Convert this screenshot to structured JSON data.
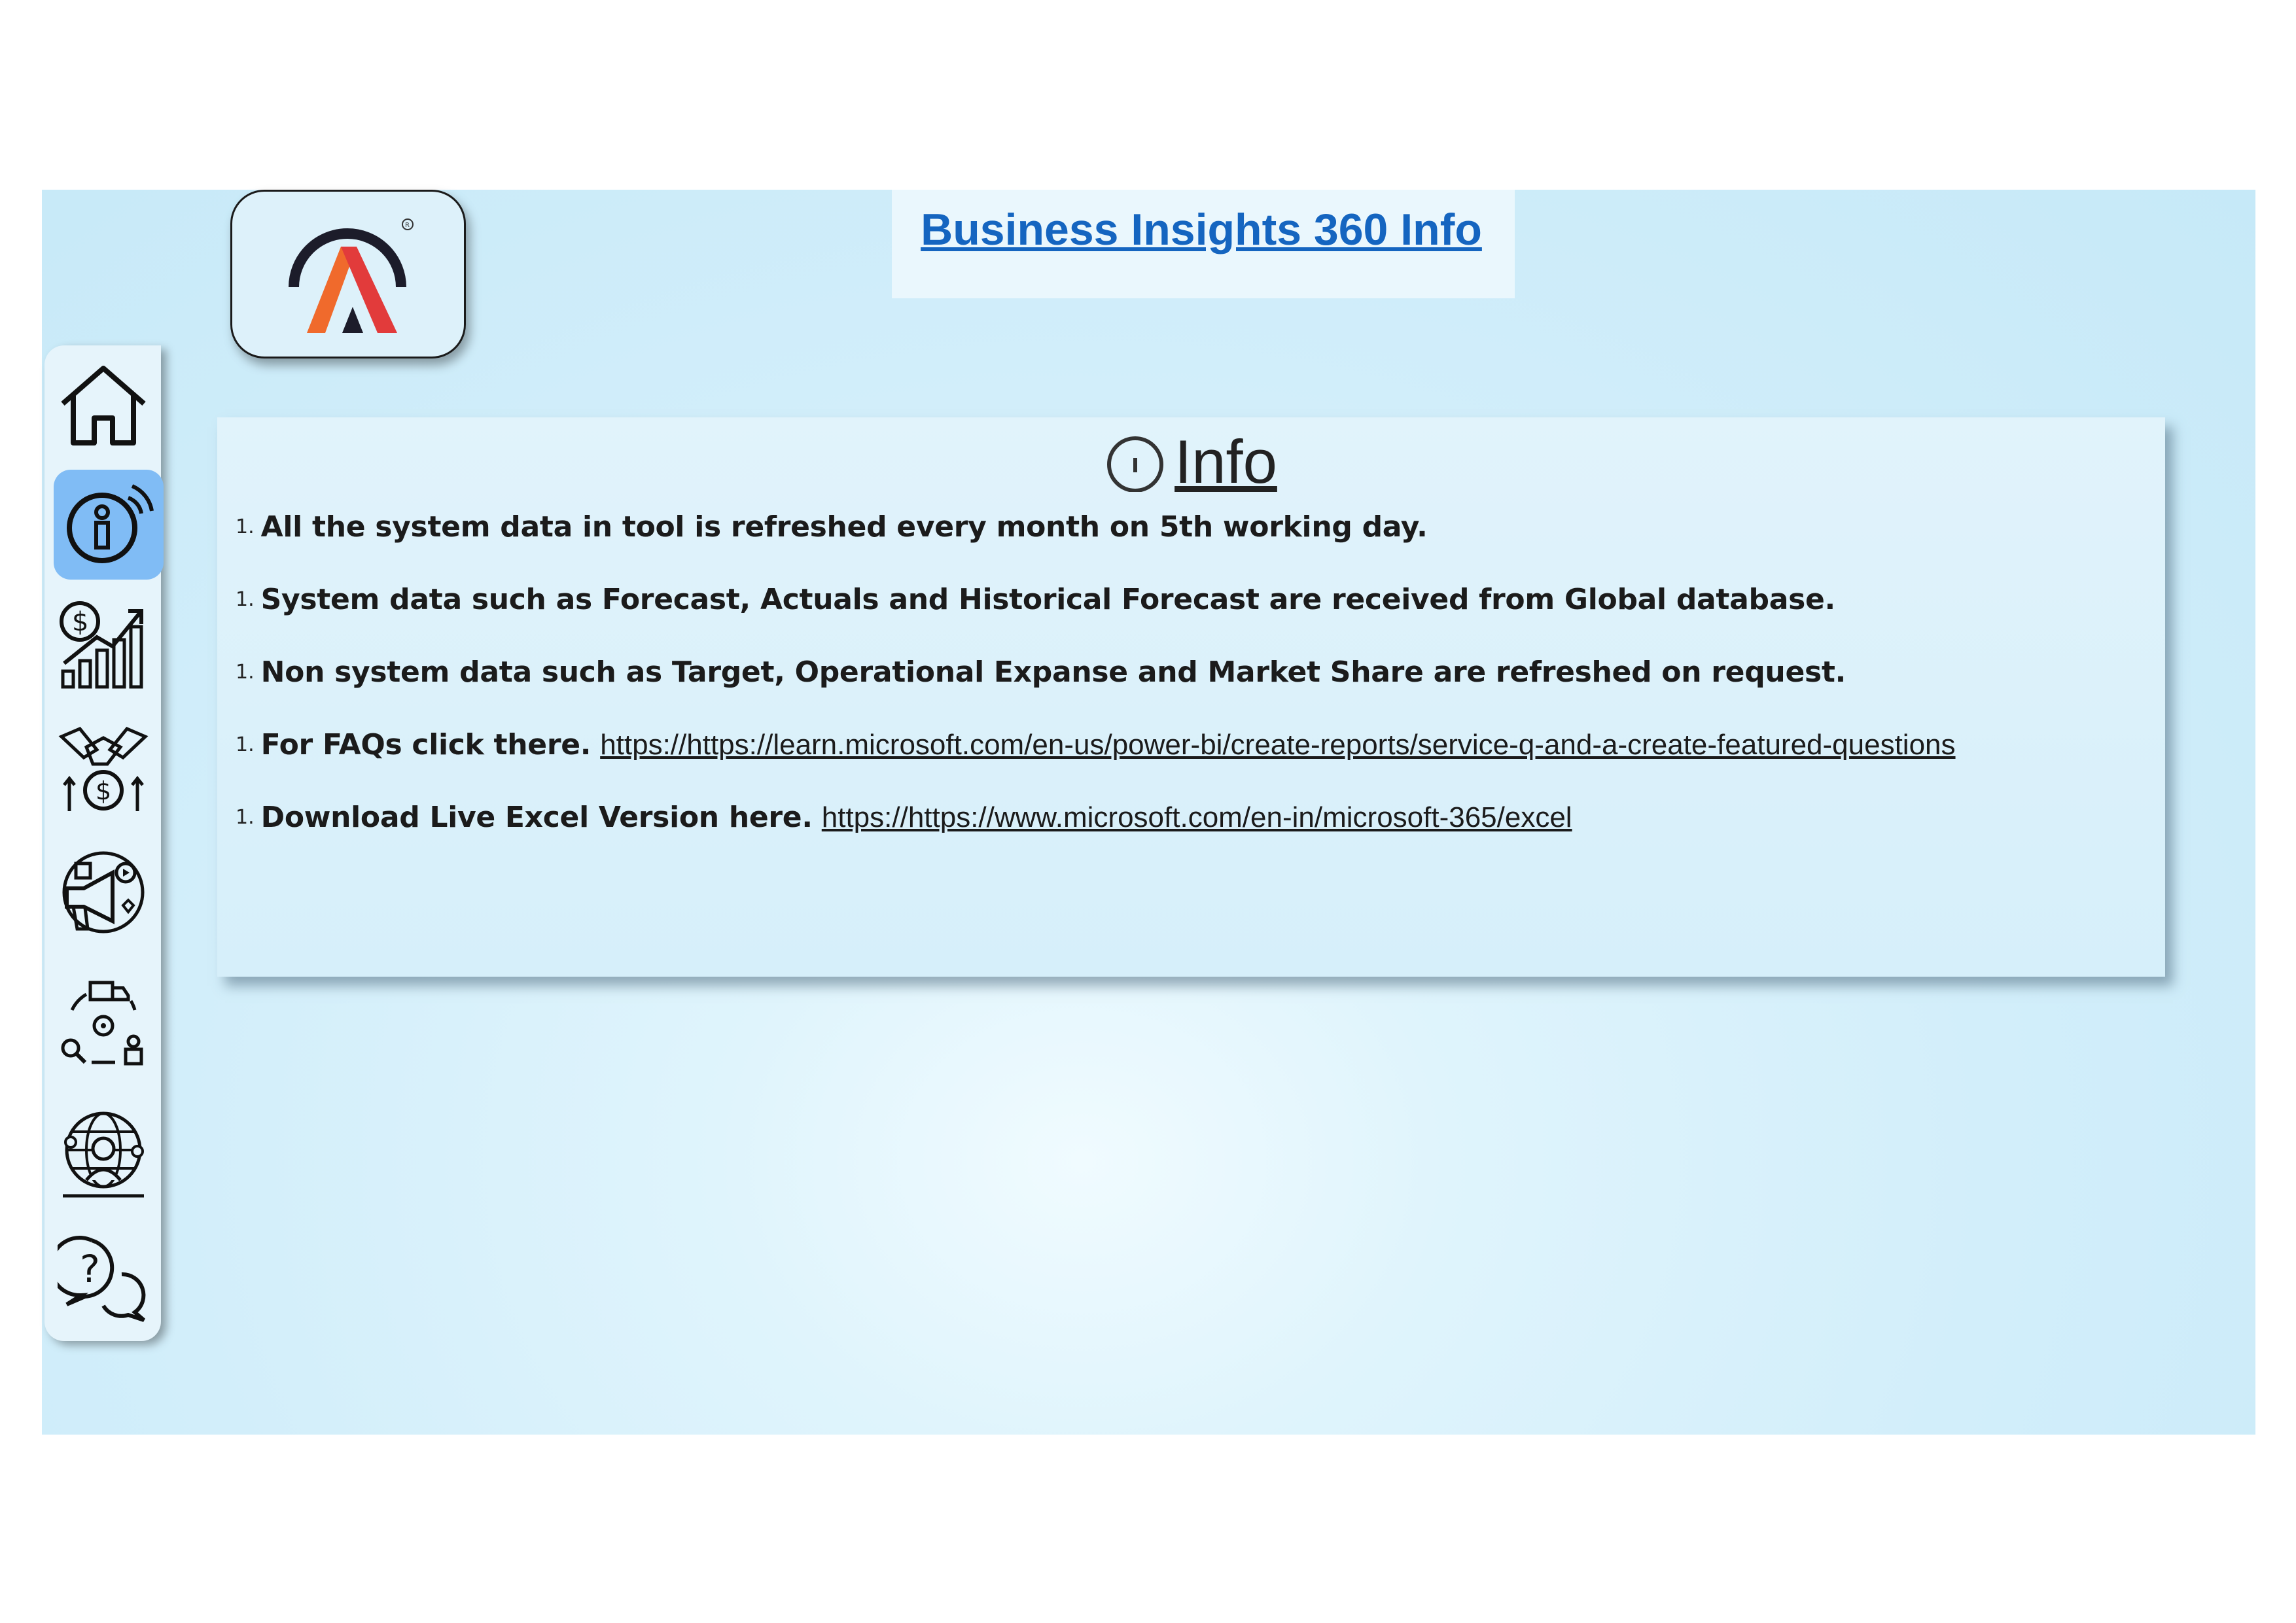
{
  "page": {
    "title": "Business Insights 360 Info"
  },
  "colors": {
    "title": "#1565c0",
    "active_nav": "#80bcf5",
    "background": "#d2eefa",
    "logo_orange": "#f06a2c",
    "logo_red": "#d93a3a"
  },
  "sidebar": {
    "items": [
      {
        "icon": "home-icon",
        "active": false
      },
      {
        "icon": "info-icon",
        "active": true
      },
      {
        "icon": "finance-growth-icon",
        "active": false
      },
      {
        "icon": "sales-handshake-icon",
        "active": false
      },
      {
        "icon": "marketing-megaphone-icon",
        "active": false
      },
      {
        "icon": "supply-chain-icon",
        "active": false
      },
      {
        "icon": "executive-globe-icon",
        "active": false
      },
      {
        "icon": "help-chat-icon",
        "active": false
      }
    ]
  },
  "info": {
    "heading": "Info",
    "items": [
      {
        "num": "1.",
        "text": "All the system data in tool is refreshed every month on 5th working day.",
        "link": ""
      },
      {
        "num": "1.",
        "text": "System data such as Forecast, Actuals and Historical Forecast are received from Global database.",
        "link": ""
      },
      {
        "num": "1.",
        "text": "Non system data such as Target, Operational Expanse and Market Share are refreshed on request.",
        "link": ""
      },
      {
        "num": "1.",
        "text": "For FAQs click there.",
        "link": "https://https://learn.microsoft.com/en-us/power-bi/create-reports/service-q-and-a-create-featured-questions"
      },
      {
        "num": "1.",
        "text": "Download Live Excel Version here.",
        "link": "https://https://www.microsoft.com/en-in/microsoft-365/excel"
      }
    ]
  }
}
